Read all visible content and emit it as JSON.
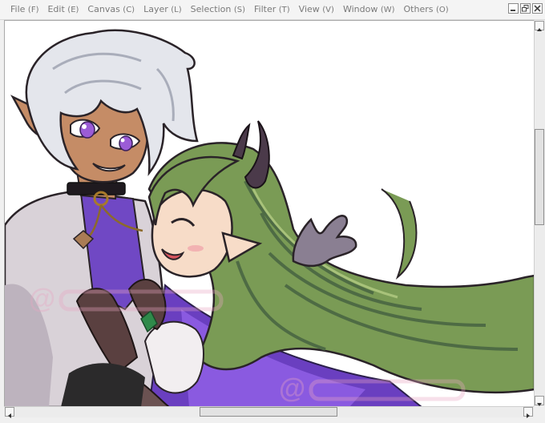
{
  "menu": [
    {
      "label": "File",
      "key": "(F)"
    },
    {
      "label": "Edit",
      "key": "(E)"
    },
    {
      "label": "Canvas",
      "key": "(C)"
    },
    {
      "label": "Layer",
      "key": "(L)"
    },
    {
      "label": "Selection",
      "key": "(S)"
    },
    {
      "label": "Filter",
      "key": "(T)"
    },
    {
      "label": "View",
      "key": "(V)"
    },
    {
      "label": "Window",
      "key": "(W)"
    },
    {
      "label": "Others",
      "key": "(O)"
    }
  ],
  "window_controls": [
    "minimize-icon",
    "restore-icon",
    "close-icon"
  ],
  "colors": {
    "hair_white": "#e4e6ec",
    "hair_green": "#7a9b55",
    "skin_tan": "#c58c66",
    "skin_pale": "#f7dcc8",
    "eyes": "#9b5cd6",
    "horn": "#4b3a4a",
    "cape_purple": "#6a3fc0",
    "coat_gray": "#d9d2d8",
    "glove": "#5a4040",
    "hand_gray": "#8a7f92",
    "watermark": "#e9a5c2"
  },
  "scroll": {
    "vertical_position": 0.32,
    "horizontal_position": 0.5
  }
}
